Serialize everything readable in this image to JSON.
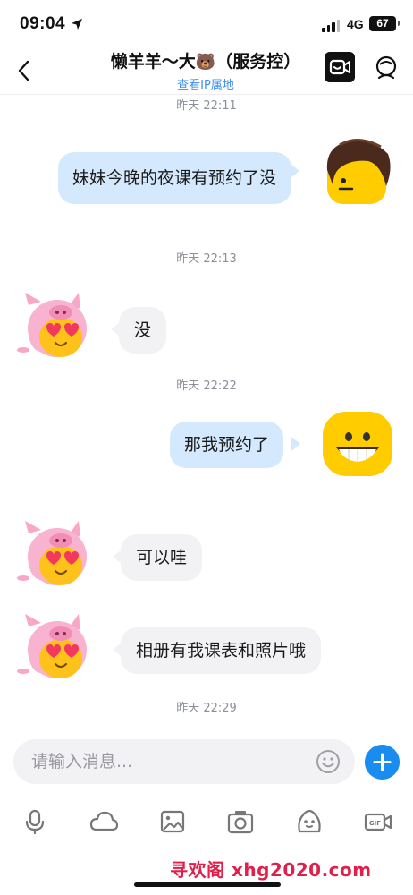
{
  "status_bar": {
    "time": "09:04",
    "network": "4G",
    "battery": "67"
  },
  "header": {
    "title": "懒羊羊～大",
    "title_emoji": "🐻",
    "title_suffix": "（服务控）",
    "subtitle": "查看IP属地"
  },
  "messages": [
    {
      "timestamp": "昨天 22:11"
    },
    {
      "direction": "sent",
      "text": "妹妹今晚的夜课有预约了没"
    },
    {
      "timestamp": "昨天 22:13"
    },
    {
      "direction": "received",
      "text": "没"
    },
    {
      "timestamp": "昨天 22:22"
    },
    {
      "direction": "sent",
      "text": "那我预约了"
    },
    {
      "direction": "received",
      "text": "可以哇"
    },
    {
      "direction": "received",
      "text": "相册有我课表和照片哦"
    },
    {
      "timestamp": "昨天 22:29"
    }
  ],
  "composer": {
    "placeholder": "请输入消息..."
  },
  "toolbar": [
    "mic-icon",
    "cloud-icon",
    "image-icon",
    "camera-icon",
    "sticker-icon",
    "gif-video-icon"
  ],
  "watermark": "寻欢阁 xhg2020.com",
  "colors": {
    "sent_bubble": "#d4e9fd",
    "received_bubble": "#f2f2f4",
    "accent": "#1a8cf0",
    "link": "#3a8ef0",
    "watermark": "#e0204a"
  }
}
